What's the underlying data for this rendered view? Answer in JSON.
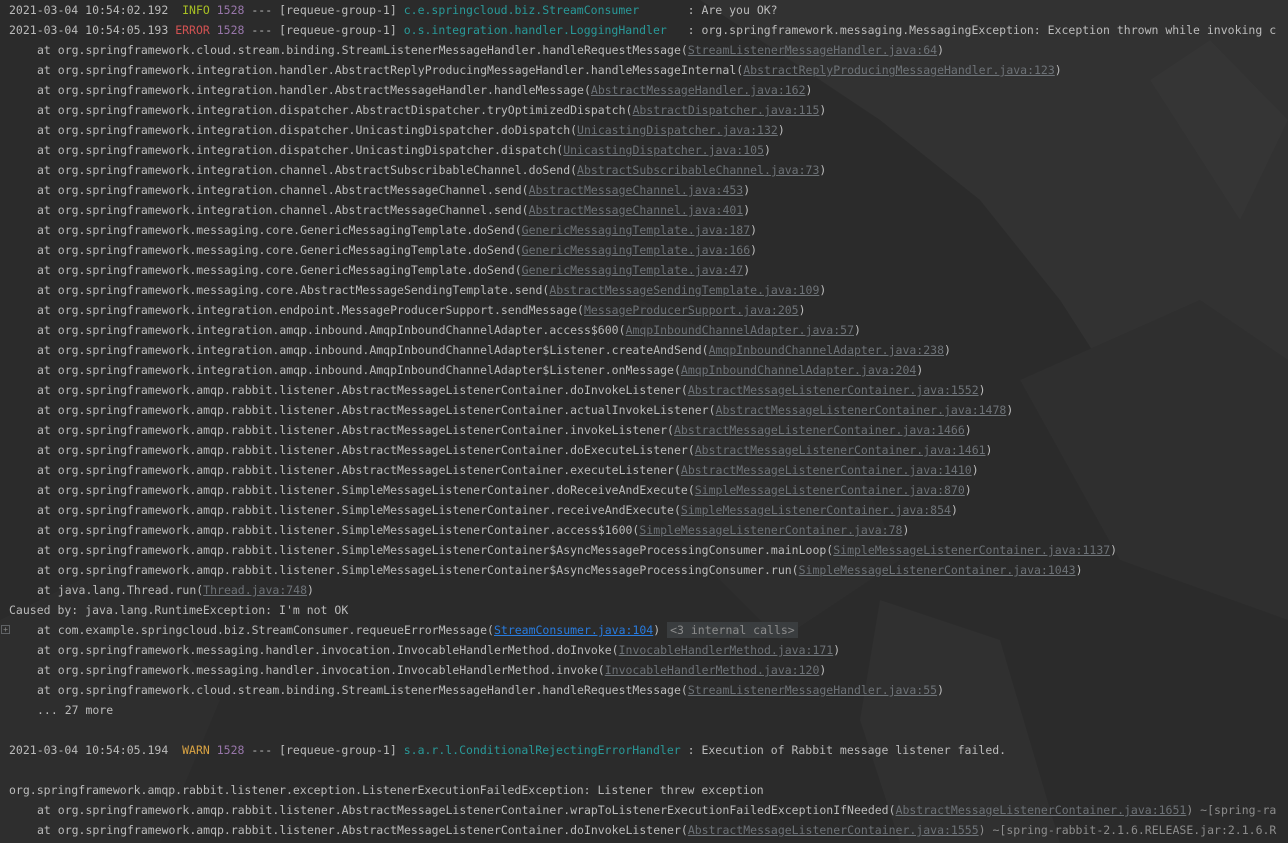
{
  "theme": {
    "background": "#2b2b2b",
    "text": "#bbbbbb",
    "info": "#a8c023",
    "error": "#d25252",
    "warn": "#d9a343",
    "pid": "#9876aa",
    "logger": "#299999",
    "link": "#6d7277",
    "link_active": "#287bde"
  },
  "fold_icon": "plus-icon",
  "log1": {
    "timestamp": "2021-03-04 10:54:02.192",
    "level": " INFO",
    "pid": "1528",
    "sep": " --- ",
    "thread": "[requeue-group-1]",
    "logger": "c.e.springcloud.biz.StreamConsumer",
    "pad": "       ",
    "message": ": Are you OK?"
  },
  "log2": {
    "timestamp": "2021-03-04 10:54:05.193",
    "level": "ERROR",
    "pid": "1528",
    "sep": " --- ",
    "thread": "[requeue-group-1]",
    "logger": "o.s.integration.handler.LoggingHandler",
    "pad": "   ",
    "message": ": org.springframework.messaging.MessagingException: Exception thrown while invoking c"
  },
  "trace1": [
    {
      "method": "at org.springframework.cloud.stream.binding.StreamListenerMessageHandler.handleRequestMessage(",
      "link": "StreamListenerMessageHandler.java:64"
    },
    {
      "method": "at org.springframework.integration.handler.AbstractReplyProducingMessageHandler.handleMessageInternal(",
      "link": "AbstractReplyProducingMessageHandler.java:123"
    },
    {
      "method": "at org.springframework.integration.handler.AbstractMessageHandler.handleMessage(",
      "link": "AbstractMessageHandler.java:162"
    },
    {
      "method": "at org.springframework.integration.dispatcher.AbstractDispatcher.tryOptimizedDispatch(",
      "link": "AbstractDispatcher.java:115"
    },
    {
      "method": "at org.springframework.integration.dispatcher.UnicastingDispatcher.doDispatch(",
      "link": "UnicastingDispatcher.java:132"
    },
    {
      "method": "at org.springframework.integration.dispatcher.UnicastingDispatcher.dispatch(",
      "link": "UnicastingDispatcher.java:105"
    },
    {
      "method": "at org.springframework.integration.channel.AbstractSubscribableChannel.doSend(",
      "link": "AbstractSubscribableChannel.java:73"
    },
    {
      "method": "at org.springframework.integration.channel.AbstractMessageChannel.send(",
      "link": "AbstractMessageChannel.java:453"
    },
    {
      "method": "at org.springframework.integration.channel.AbstractMessageChannel.send(",
      "link": "AbstractMessageChannel.java:401"
    },
    {
      "method": "at org.springframework.messaging.core.GenericMessagingTemplate.doSend(",
      "link": "GenericMessagingTemplate.java:187"
    },
    {
      "method": "at org.springframework.messaging.core.GenericMessagingTemplate.doSend(",
      "link": "GenericMessagingTemplate.java:166"
    },
    {
      "method": "at org.springframework.messaging.core.GenericMessagingTemplate.doSend(",
      "link": "GenericMessagingTemplate.java:47"
    },
    {
      "method": "at org.springframework.messaging.core.AbstractMessageSendingTemplate.send(",
      "link": "AbstractMessageSendingTemplate.java:109"
    },
    {
      "method": "at org.springframework.integration.endpoint.MessageProducerSupport.sendMessage(",
      "link": "MessageProducerSupport.java:205"
    },
    {
      "method": "at org.springframework.integration.amqp.inbound.AmqpInboundChannelAdapter.access$600(",
      "link": "AmqpInboundChannelAdapter.java:57"
    },
    {
      "method": "at org.springframework.integration.amqp.inbound.AmqpInboundChannelAdapter$Listener.createAndSend(",
      "link": "AmqpInboundChannelAdapter.java:238"
    },
    {
      "method": "at org.springframework.integration.amqp.inbound.AmqpInboundChannelAdapter$Listener.onMessage(",
      "link": "AmqpInboundChannelAdapter.java:204"
    },
    {
      "method": "at org.springframework.amqp.rabbit.listener.AbstractMessageListenerContainer.doInvokeListener(",
      "link": "AbstractMessageListenerContainer.java:1552"
    },
    {
      "method": "at org.springframework.amqp.rabbit.listener.AbstractMessageListenerContainer.actualInvokeListener(",
      "link": "AbstractMessageListenerContainer.java:1478"
    },
    {
      "method": "at org.springframework.amqp.rabbit.listener.AbstractMessageListenerContainer.invokeListener(",
      "link": "AbstractMessageListenerContainer.java:1466"
    },
    {
      "method": "at org.springframework.amqp.rabbit.listener.AbstractMessageListenerContainer.doExecuteListener(",
      "link": "AbstractMessageListenerContainer.java:1461"
    },
    {
      "method": "at org.springframework.amqp.rabbit.listener.AbstractMessageListenerContainer.executeListener(",
      "link": "AbstractMessageListenerContainer.java:1410"
    },
    {
      "method": "at org.springframework.amqp.rabbit.listener.SimpleMessageListenerContainer.doReceiveAndExecute(",
      "link": "SimpleMessageListenerContainer.java:870"
    },
    {
      "method": "at org.springframework.amqp.rabbit.listener.SimpleMessageListenerContainer.receiveAndExecute(",
      "link": "SimpleMessageListenerContainer.java:854"
    },
    {
      "method": "at org.springframework.amqp.rabbit.listener.SimpleMessageListenerContainer.access$1600(",
      "link": "SimpleMessageListenerContainer.java:78"
    },
    {
      "method": "at org.springframework.amqp.rabbit.listener.SimpleMessageListenerContainer$AsyncMessageProcessingConsumer.mainLoop(",
      "link": "SimpleMessageListenerContainer.java:1137"
    },
    {
      "method": "at org.springframework.amqp.rabbit.listener.SimpleMessageListenerContainer$AsyncMessageProcessingConsumer.run(",
      "link": "SimpleMessageListenerContainer.java:1043"
    },
    {
      "method": "at java.lang.Thread.run(",
      "link": "Thread.java:748"
    }
  ],
  "caused_by": "Caused by: java.lang.RuntimeException: I'm not OK",
  "cause_first": {
    "method": "at com.example.springcloud.biz.StreamConsumer.requeueErrorMessage(",
    "link": "StreamConsumer.java:104",
    "close": ")",
    "internal": "<3 internal calls>"
  },
  "trace2": [
    {
      "method": "at org.springframework.messaging.handler.invocation.InvocableHandlerMethod.doInvoke(",
      "link": "InvocableHandlerMethod.java:171"
    },
    {
      "method": "at org.springframework.messaging.handler.invocation.InvocableHandlerMethod.invoke(",
      "link": "InvocableHandlerMethod.java:120"
    },
    {
      "method": "at org.springframework.cloud.stream.binding.StreamListenerMessageHandler.handleRequestMessage(",
      "link": "StreamListenerMessageHandler.java:55"
    }
  ],
  "more": "... 27 more",
  "log3": {
    "timestamp": "2021-03-04 10:54:05.194",
    "level": " WARN",
    "pid": "1528",
    "sep": " --- ",
    "thread": "[requeue-group-1]",
    "logger": "s.a.r.l.ConditionalRejectingErrorHandler",
    "pad": " ",
    "message": ": Execution of Rabbit message listener failed."
  },
  "exception2": "org.springframework.amqp.rabbit.listener.exception.ListenerExecutionFailedException: Listener threw exception",
  "trace3": [
    {
      "method": "at org.springframework.amqp.rabbit.listener.AbstractMessageListenerContainer.wrapToListenerExecutionFailedExceptionIfNeeded(",
      "link": "AbstractMessageListenerContainer.java:1651",
      "suffix": ") ~[spring-ra"
    },
    {
      "method": "at org.springframework.amqp.rabbit.listener.AbstractMessageListenerContainer.doInvokeListener(",
      "link": "AbstractMessageListenerContainer.java:1555",
      "suffix": ") ~[spring-rabbit-2.1.6.RELEASE.jar:2.1.6.R"
    }
  ]
}
